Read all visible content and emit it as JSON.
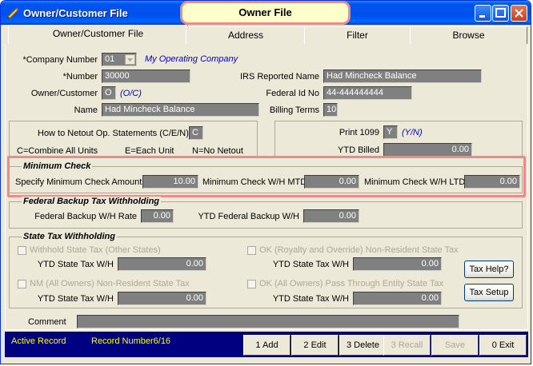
{
  "window": {
    "title": "Owner/Customer File",
    "center_title": "Owner File",
    "title_color": "#0054E3",
    "highlight_color": "#EE8A8A"
  },
  "tabs": [
    "Owner/Customer File",
    "Address",
    "Filter",
    "Browse"
  ],
  "form": {
    "company_number": {
      "label": "*Company Number",
      "value": "01",
      "company_name": "My Operating Company"
    },
    "number": {
      "label": "*Number",
      "value": "30000"
    },
    "owner_customer": {
      "label": "Owner/Customer",
      "value": "O",
      "hint": "(O/C)"
    },
    "name": {
      "label": "Name",
      "value": "Had Mincheck Balance"
    },
    "irs_name": {
      "label": "IRS Reported Name",
      "value": "Had Mincheck Balance"
    },
    "federal_id": {
      "label": "Federal Id No",
      "value": "44-444444444"
    },
    "billing_terms": {
      "label": "Billing Terms",
      "value": "10"
    },
    "netout": {
      "label": "How to Netout Op. Statements (C/E/N)",
      "value": "C",
      "opt_c": "C=Combine All Units",
      "opt_e": "E=Each Unit",
      "opt_n": "N=No Netout"
    },
    "print_1099": {
      "label": "Print 1099",
      "value": "Y",
      "hint": "(Y/N)"
    },
    "ytd_billed": {
      "label": "YTD Billed",
      "value": "0.00"
    }
  },
  "minimum_check": {
    "title": "Minimum Check",
    "specify_label": "Specify Minimum Check Amount",
    "specify_value": "10.00",
    "mtd_label": "Minimum Check W/H MTD",
    "mtd_value": "0.00",
    "ltd_label": "Minimum Check W/H LTD",
    "ltd_value": "0.00"
  },
  "federal_backup": {
    "title": "Federal Backup Tax Withholding",
    "rate_label": "Federal Backup W/H Rate",
    "rate_value": "0.00",
    "ytd_label": "YTD Federal Backup W/H",
    "ytd_value": "0.00"
  },
  "state_tax": {
    "title": "State Tax Withholding",
    "cb1_label": "Withhold State Tax (Other States)",
    "cb2_label": "OK (Royalty and Override) Non-Resident State Tax",
    "cb3_label": "NM (All Owners) Non-Resident State Tax",
    "cb4_label": "OK (All Owners) Pass Through Entity State Tax",
    "ytd_label": "YTD State Tax W/H",
    "ytd1": "0.00",
    "ytd2": "0.00",
    "ytd3": "0.00",
    "ytd4": "0.00",
    "help_button": "Tax Help?",
    "setup_button": "Tax Setup"
  },
  "comment": {
    "label": "Comment",
    "value": ""
  },
  "status": {
    "state": "Active Record",
    "record": "Record Number6/16"
  },
  "actions": {
    "add": "1 Add",
    "edit": "2 Edit",
    "delete": "3 Delete",
    "recall": "3 Recall",
    "save": "Save",
    "exit": "0 Exit"
  }
}
